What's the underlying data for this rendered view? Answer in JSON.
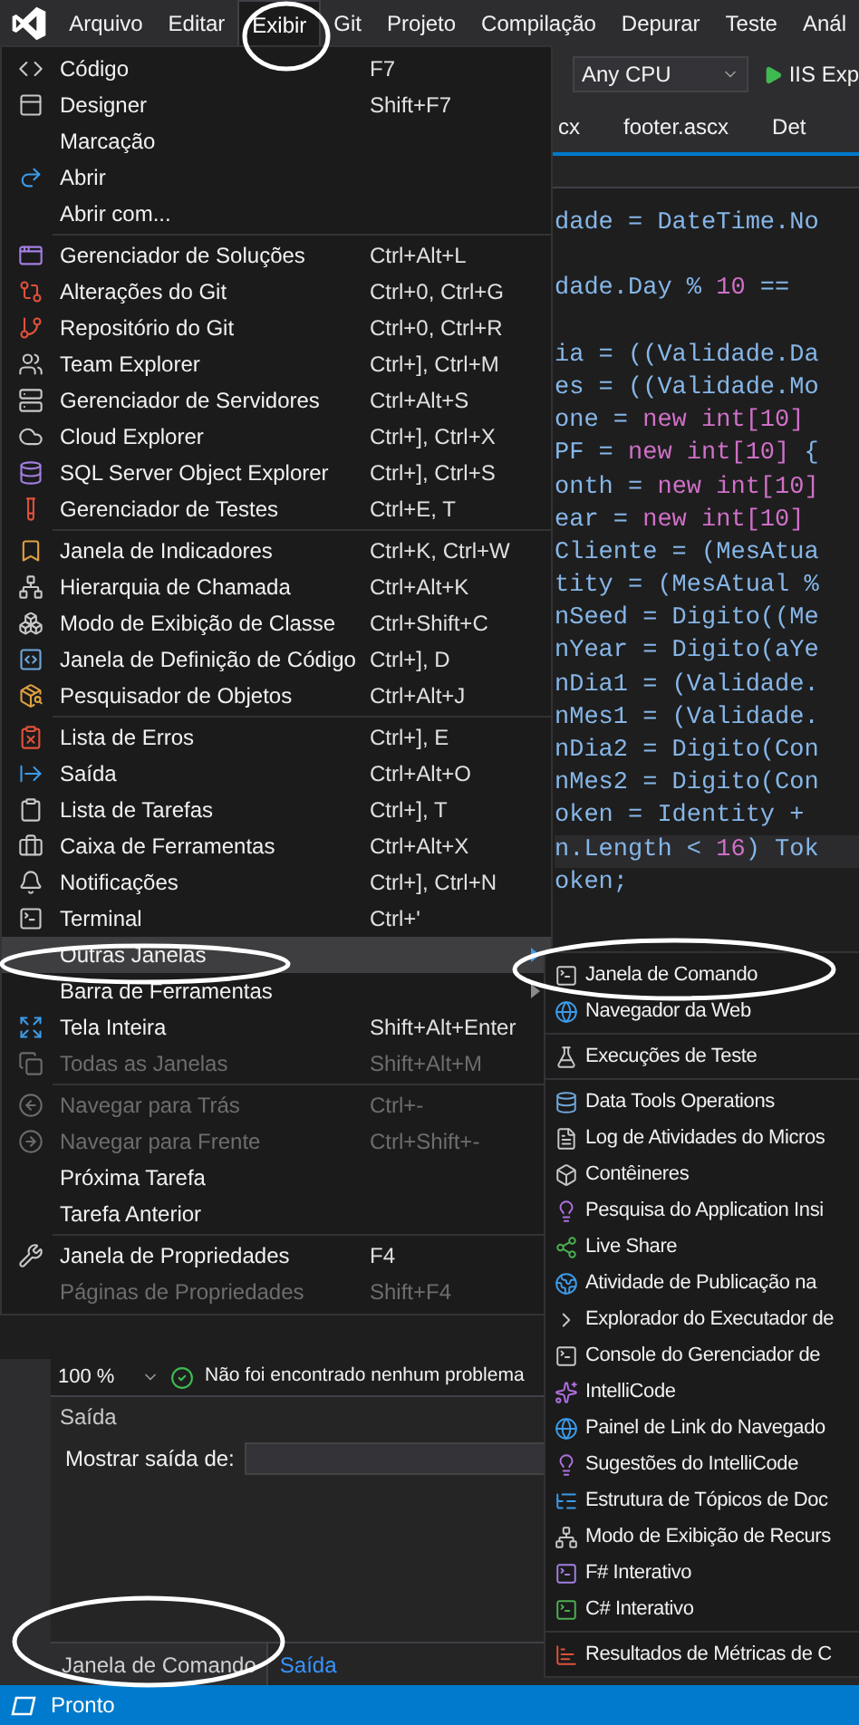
{
  "menubar": {
    "items": [
      {
        "label": "Arquivo",
        "selected": false
      },
      {
        "label": "Editar",
        "selected": false
      },
      {
        "label": "Exibir",
        "selected": true
      },
      {
        "label": "Git",
        "selected": false
      },
      {
        "label": "Projeto",
        "selected": false
      },
      {
        "label": "Compilação",
        "selected": false
      },
      {
        "label": "Depurar",
        "selected": false
      },
      {
        "label": "Teste",
        "selected": false
      },
      {
        "label": "Anál",
        "selected": false
      }
    ]
  },
  "toolbar": {
    "platform": "Any CPU",
    "run_target": "IIS Exp"
  },
  "tabs": [
    {
      "label": "cx"
    },
    {
      "label": "footer.ascx"
    },
    {
      "label": "Det"
    }
  ],
  "code_blocks": [
    {
      "lines": [
        {
          "highlighted": false,
          "segments": [
            {
              "text": "dade = DateTime.No",
              "kind": "plain"
            }
          ]
        }
      ]
    },
    {
      "lines": [
        {
          "highlighted": false,
          "segments": [
            {
              "text": "dade.Day % ",
              "kind": "plain"
            },
            {
              "text": "10",
              "kind": "accent"
            },
            {
              "text": " ==",
              "kind": "plain"
            }
          ]
        }
      ]
    },
    {
      "lines": [
        {
          "highlighted": false,
          "segments": [
            {
              "text": "ia = ((Validade.Da",
              "kind": "plain"
            }
          ]
        },
        {
          "highlighted": false,
          "segments": [
            {
              "text": "es = ((Validade.Mo",
              "kind": "plain"
            }
          ]
        },
        {
          "highlighted": false,
          "segments": [
            {
              "text": "one = ",
              "kind": "plain"
            },
            {
              "text": "new int[10]",
              "kind": "accent"
            }
          ]
        },
        {
          "highlighted": false,
          "segments": [
            {
              "text": "PF = ",
              "kind": "plain"
            },
            {
              "text": "new int[10]",
              "kind": "accent"
            },
            {
              "text": " {",
              "kind": "plain"
            }
          ]
        },
        {
          "highlighted": false,
          "segments": [
            {
              "text": "onth = ",
              "kind": "plain"
            },
            {
              "text": "new int[10]",
              "kind": "accent"
            }
          ]
        },
        {
          "highlighted": false,
          "segments": [
            {
              "text": "ear = ",
              "kind": "plain"
            },
            {
              "text": "new int[10]",
              "kind": "accent"
            }
          ]
        },
        {
          "highlighted": false,
          "segments": [
            {
              "text": "Cliente = (MesAtua",
              "kind": "plain"
            }
          ]
        },
        {
          "highlighted": false,
          "segments": [
            {
              "text": "tity = (MesAtual %",
              "kind": "plain"
            }
          ]
        },
        {
          "highlighted": false,
          "segments": [
            {
              "text": "nSeed = Digito((Me",
              "kind": "plain"
            }
          ]
        },
        {
          "highlighted": false,
          "segments": [
            {
              "text": "nYear = Digito(aYe",
              "kind": "plain"
            }
          ]
        },
        {
          "highlighted": false,
          "segments": [
            {
              "text": "nDia1 = (Validade.",
              "kind": "plain"
            }
          ]
        },
        {
          "highlighted": false,
          "segments": [
            {
              "text": "nMes1 = (Validade.",
              "kind": "plain"
            }
          ]
        },
        {
          "highlighted": false,
          "segments": [
            {
              "text": "nDia2 = Digito(Con",
              "kind": "plain"
            }
          ]
        },
        {
          "highlighted": false,
          "segments": [
            {
              "text": "nMes2 = Digito(Con",
              "kind": "plain"
            }
          ]
        },
        {
          "highlighted": false,
          "segments": [
            {
              "text": "oken = Identity +",
              "kind": "plain"
            }
          ]
        },
        {
          "highlighted": true,
          "segments": [
            {
              "text": "n.Length < ",
              "kind": "plain"
            },
            {
              "text": "16",
              "kind": "accent"
            },
            {
              "text": ") Tok",
              "kind": "plain"
            }
          ]
        },
        {
          "highlighted": false,
          "segments": [
            {
              "text": "oken;",
              "kind": "plain"
            }
          ]
        }
      ]
    }
  ],
  "status_strip": {
    "zoom": "100 %",
    "message": "Não foi encontrado nenhum problema"
  },
  "output": {
    "title": "Saída",
    "source_label": "Mostrar saída de:"
  },
  "bottom_tabs": [
    {
      "label": "Janela de Comando",
      "selected": false
    },
    {
      "label": "Saída",
      "selected": true
    }
  ],
  "status_bar": {
    "text": "Pronto"
  },
  "view_menu": {
    "groups": [
      {
        "items": [
          {
            "label": "Código",
            "shortcut": "F7",
            "selected": false,
            "disabled": false,
            "submenu": false
          },
          {
            "label": "Designer",
            "shortcut": "Shift+F7",
            "selected": false,
            "disabled": false,
            "submenu": false
          },
          {
            "label": "Marcação",
            "selected": false,
            "disabled": false,
            "submenu": false
          },
          {
            "label": "Abrir",
            "selected": false,
            "disabled": false,
            "submenu": false
          },
          {
            "label": "Abrir com...",
            "selected": false,
            "disabled": false,
            "submenu": false
          }
        ]
      },
      {
        "items": [
          {
            "label": "Gerenciador de Soluções",
            "shortcut": "Ctrl+Alt+L",
            "selected": false,
            "disabled": false,
            "submenu": false
          },
          {
            "label": "Alterações do Git",
            "shortcut": "Ctrl+0, Ctrl+G",
            "selected": false,
            "disabled": false,
            "submenu": false
          },
          {
            "label": "Repositório do Git",
            "shortcut": "Ctrl+0, Ctrl+R",
            "selected": false,
            "disabled": false,
            "submenu": false
          },
          {
            "label": "Team Explorer",
            "shortcut": "Ctrl+], Ctrl+M",
            "selected": false,
            "disabled": false,
            "submenu": false
          },
          {
            "label": "Gerenciador de Servidores",
            "shortcut": "Ctrl+Alt+S",
            "selected": false,
            "disabled": false,
            "submenu": false
          },
          {
            "label": "Cloud Explorer",
            "shortcut": "Ctrl+], Ctrl+X",
            "selected": false,
            "disabled": false,
            "submenu": false
          },
          {
            "label": "SQL Server Object Explorer",
            "shortcut": "Ctrl+], Ctrl+S",
            "selected": false,
            "disabled": false,
            "submenu": false
          },
          {
            "label": "Gerenciador de Testes",
            "shortcut": "Ctrl+E, T",
            "selected": false,
            "disabled": false,
            "submenu": false
          }
        ]
      },
      {
        "items": [
          {
            "label": "Janela de Indicadores",
            "shortcut": "Ctrl+K, Ctrl+W",
            "selected": false,
            "disabled": false,
            "submenu": false
          },
          {
            "label": "Hierarquia de Chamada",
            "shortcut": "Ctrl+Alt+K",
            "selected": false,
            "disabled": false,
            "submenu": false
          },
          {
            "label": "Modo de Exibição de Classe",
            "shortcut": "Ctrl+Shift+C",
            "selected": false,
            "disabled": false,
            "submenu": false
          },
          {
            "label": "Janela de Definição de Código",
            "shortcut": "Ctrl+], D",
            "selected": false,
            "disabled": false,
            "submenu": false
          },
          {
            "label": "Pesquisador de Objetos",
            "shortcut": "Ctrl+Alt+J",
            "selected": false,
            "disabled": false,
            "submenu": false
          }
        ]
      },
      {
        "items": [
          {
            "label": "Lista de Erros",
            "shortcut": "Ctrl+], E",
            "selected": false,
            "disabled": false,
            "submenu": false
          },
          {
            "label": "Saída",
            "shortcut": "Ctrl+Alt+O",
            "selected": false,
            "disabled": false,
            "submenu": false
          },
          {
            "label": "Lista de Tarefas",
            "shortcut": "Ctrl+], T",
            "selected": false,
            "disabled": false,
            "submenu": false
          },
          {
            "label": "Caixa de Ferramentas",
            "shortcut": "Ctrl+Alt+X",
            "selected": false,
            "disabled": false,
            "submenu": false
          },
          {
            "label": "Notificações",
            "shortcut": "Ctrl+], Ctrl+N",
            "selected": false,
            "disabled": false,
            "submenu": false
          },
          {
            "label": "Terminal",
            "shortcut": "Ctrl+'",
            "selected": false,
            "disabled": false,
            "submenu": false
          },
          {
            "label": "Outras Janelas",
            "selected": true,
            "disabled": false,
            "submenu": true
          },
          {
            "label": "Barra de Ferramentas",
            "selected": false,
            "disabled": false,
            "submenu": true
          },
          {
            "label": "Tela Inteira",
            "shortcut": "Shift+Alt+Enter",
            "selected": false,
            "disabled": false,
            "submenu": false
          },
          {
            "label": "Todas as Janelas",
            "shortcut": "Shift+Alt+M",
            "selected": false,
            "disabled": true,
            "submenu": false
          }
        ]
      },
      {
        "items": [
          {
            "label": "Navegar para Trás",
            "shortcut": "Ctrl+-",
            "selected": false,
            "disabled": true,
            "submenu": false
          },
          {
            "label": "Navegar para Frente",
            "shortcut": "Ctrl+Shift+-",
            "selected": false,
            "disabled": true,
            "submenu": false
          },
          {
            "label": "Próxima Tarefa",
            "selected": false,
            "disabled": false,
            "submenu": false
          },
          {
            "label": "Tarefa Anterior",
            "selected": false,
            "disabled": false,
            "submenu": false
          }
        ]
      },
      {
        "items": [
          {
            "label": "Janela de Propriedades",
            "shortcut": "F4",
            "selected": false,
            "disabled": false,
            "submenu": false
          },
          {
            "label": "Páginas de Propriedades",
            "shortcut": "Shift+F4",
            "selected": false,
            "disabled": true,
            "submenu": false
          }
        ]
      }
    ]
  },
  "other_windows_submenu": {
    "groups": [
      {
        "items": [
          {
            "label": "Janela de Comando"
          },
          {
            "label": "Navegador da Web"
          }
        ]
      },
      {
        "items": [
          {
            "label": "Execuções de Teste"
          }
        ]
      },
      {
        "items": [
          {
            "label": "Data Tools Operations"
          },
          {
            "label": "Log de Atividades do Micros"
          },
          {
            "label": "Contêineres"
          },
          {
            "label": "Pesquisa do Application Insi"
          },
          {
            "label": "Live Share"
          },
          {
            "label": "Atividade de Publicação na"
          },
          {
            "label": "Explorador do Executador de"
          },
          {
            "label": "Console do Gerenciador de"
          },
          {
            "label": "IntelliCode"
          },
          {
            "label": "Painel de Link do Navegado"
          },
          {
            "label": "Sugestões do IntelliCode"
          },
          {
            "label": "Estrutura de Tópicos de Doc"
          },
          {
            "label": "Modo de Exibição de Recurs"
          },
          {
            "label": "F# Interativo"
          },
          {
            "label": "C# Interativo"
          }
        ]
      },
      {
        "items": [
          {
            "label": "Resultados de Métricas de C"
          }
        ]
      }
    ]
  }
}
